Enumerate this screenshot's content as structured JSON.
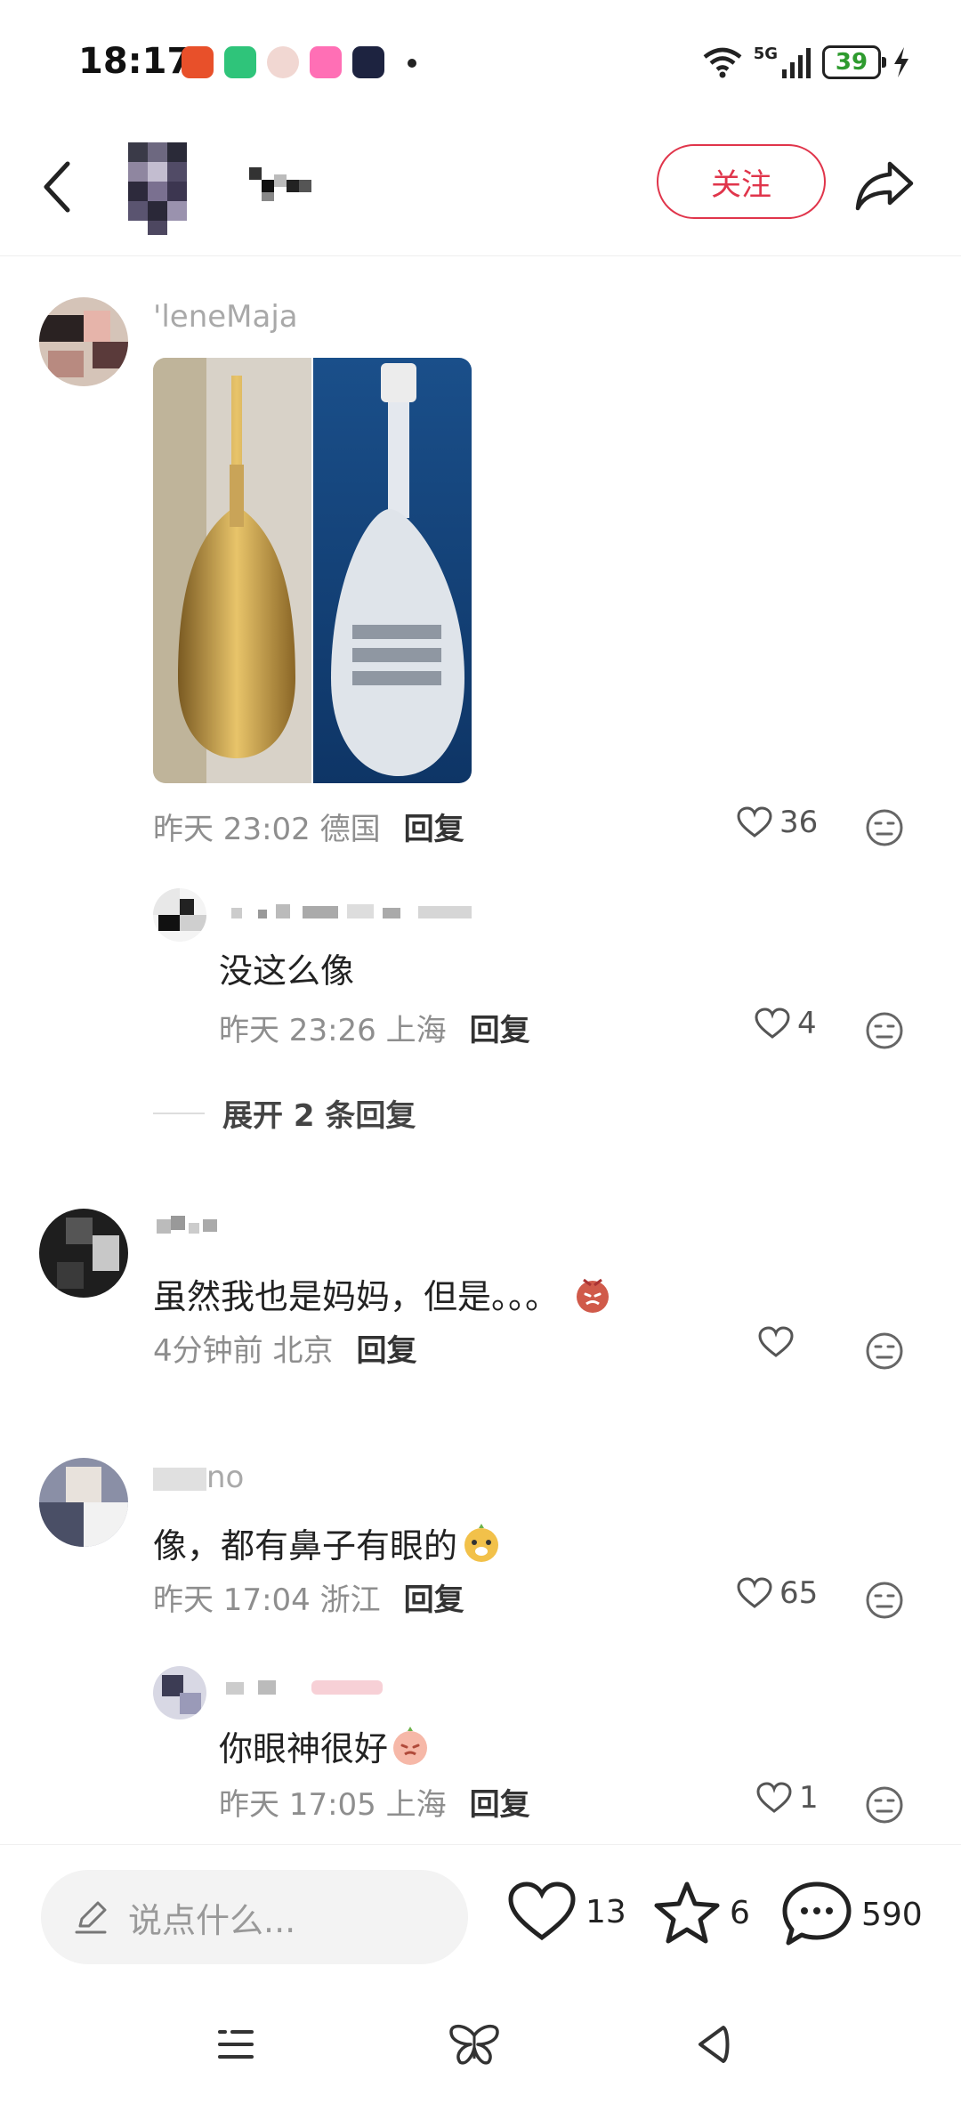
{
  "status_bar": {
    "time": "18:17",
    "network": "5G",
    "battery": "39",
    "app_icons": [
      "shopping-bag-icon",
      "battery-saver-icon",
      "avatar-app-icon",
      "camera-app-icon",
      "video-app-icon"
    ]
  },
  "header": {
    "follow_label": "关注"
  },
  "comments": [
    {
      "username": "'leneMaja",
      "meta_time": "昨天 23:02",
      "meta_location": "德国",
      "reply_label": "回复",
      "likes": "36",
      "reply": {
        "username": "",
        "text": "没这么像",
        "meta_time": "昨天 23:26",
        "meta_location": "上海",
        "reply_label": "回复",
        "likes": "4"
      },
      "expand_label": "展开 2 条回复"
    },
    {
      "username": "",
      "text": "虽然我也是妈妈，但是。。。",
      "meta_time": "4分钟前",
      "meta_location": "北京",
      "reply_label": "回复",
      "likes": ""
    },
    {
      "username": "no",
      "text": "像，都有鼻子有眼的",
      "meta_time": "昨天 17:04",
      "meta_location": "浙江",
      "reply_label": "回复",
      "likes": "65",
      "reply": {
        "username": "",
        "text": "你眼神很好",
        "meta_time": "昨天 17:05",
        "meta_location": "上海",
        "reply_label": "回复",
        "likes": "1"
      }
    }
  ],
  "bottom_bar": {
    "input_placeholder": "说点什么...",
    "like_count": "13",
    "star_count": "6",
    "comment_count": "590"
  },
  "colors": {
    "accent": "#e0354b",
    "meta_gray": "#8e8e8e",
    "background": "#ffffff"
  }
}
